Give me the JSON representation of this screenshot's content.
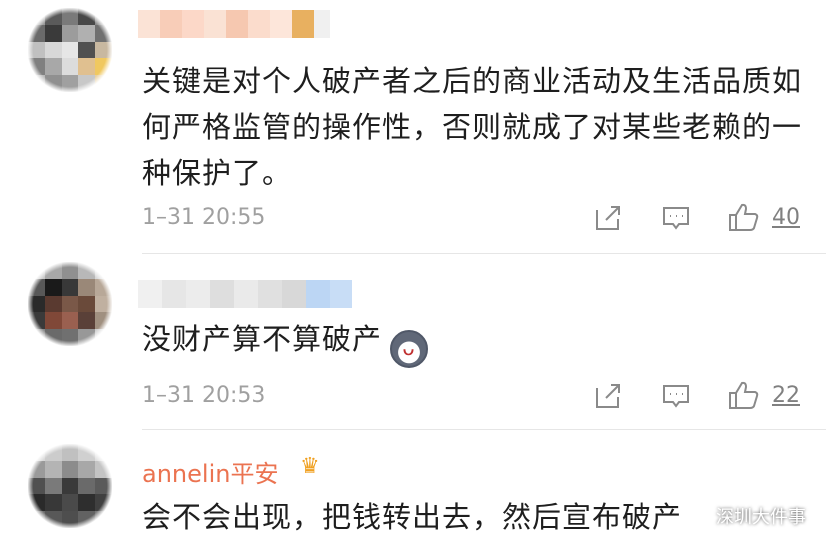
{
  "comments": [
    {
      "text": "关键是对个人破产者之后的商业活动及生活品质如何严格监管的操作性，否则就成了对某些老赖的一种保护了。",
      "time": "1–31 20:55",
      "likes": "40"
    },
    {
      "text": "没财产算不算破产",
      "time": "1–31 20:53",
      "likes": "22"
    },
    {
      "user": "annelin平安",
      "text": "会不会出现，把钱转出去，然后宣布破产"
    }
  ],
  "watermark": "深圳大件事",
  "icons": {
    "share": "share-icon",
    "comment": "comment-icon",
    "like": "like-icon",
    "crown": "crown-badge-icon",
    "emoji": "dog-emoji-icon",
    "watermark": "wechat-logo-icon"
  },
  "colors": {
    "username": "#eb7350",
    "meta_text": "#a0a0a0",
    "body_text": "#1e1e1e"
  }
}
